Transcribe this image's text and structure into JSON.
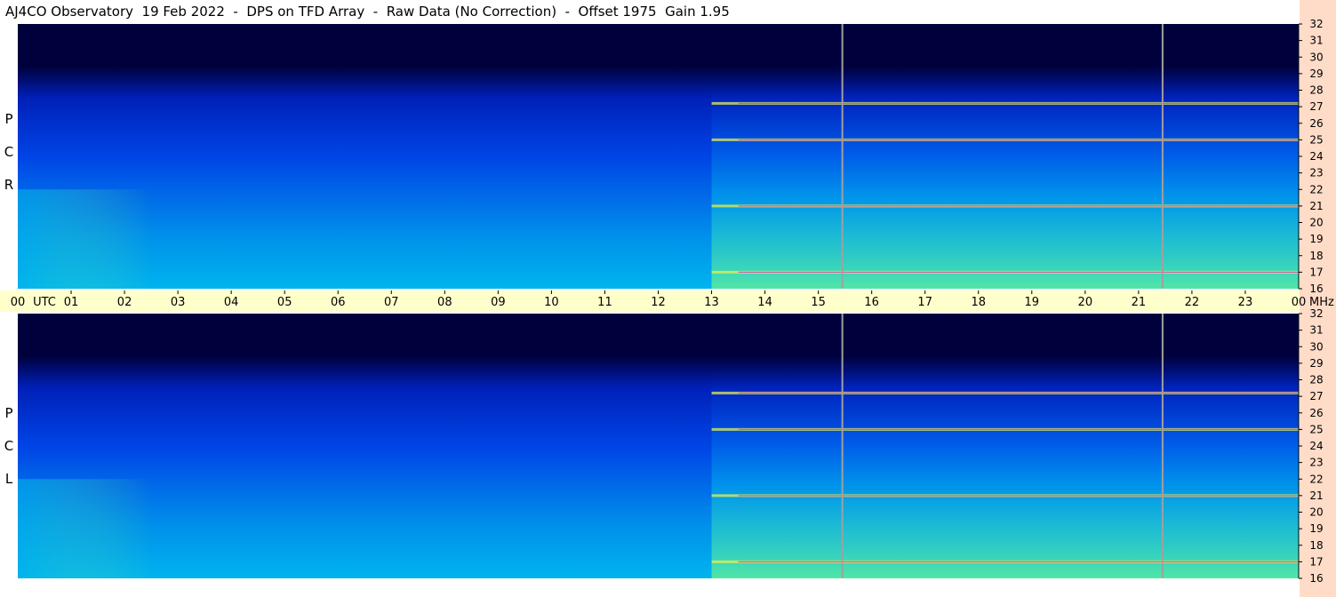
{
  "title": "AJ4CO Observatory  19 Feb 2022  -  DPS on TFD Array  -  Raw Data (No Correction)  -  Offset 1975  Gain 1.95",
  "colors": {
    "background": "#ffffff",
    "utc_band": "#ffffcc",
    "side_band": "#ffdcc8",
    "spectro_dark": "#00003c",
    "spectro_blue": "#0044e6",
    "spectro_cyan": "#00b4ee",
    "spectro_green": "#5fee9a",
    "spectro_yellow": "#e6f050",
    "spectro_magenta": "#d03cbe",
    "marker_line": "#a0a0a0"
  },
  "chart_data": {
    "type": "heatmap",
    "title": "AJ4CO Observatory  19 Feb 2022  -  DPS on TFD Array  -  Raw Data (No Correction)  -  Offset 1975  Gain 1.95",
    "x_axis": {
      "start_label": "00",
      "unit_label": "UTC",
      "tick_labels": [
        "01",
        "02",
        "03",
        "04",
        "05",
        "06",
        "07",
        "08",
        "09",
        "10",
        "11",
        "12",
        "13",
        "14",
        "15",
        "16",
        "17",
        "18",
        "19",
        "20",
        "21",
        "22",
        "23"
      ],
      "end_label": "00",
      "end_unit_label": "MHz",
      "range_hours": [
        0,
        24
      ]
    },
    "y_axis": {
      "unit": "MHz",
      "range": [
        16,
        32
      ],
      "tick_labels": [
        "32",
        "31",
        "30",
        "29",
        "28",
        "27",
        "26",
        "25",
        "24",
        "23",
        "22",
        "21",
        "20",
        "19",
        "18",
        "17",
        "16"
      ]
    },
    "panels": [
      {
        "letters": [
          "R",
          "C",
          "P"
        ]
      },
      {
        "letters": [
          "L",
          "C",
          "P"
        ]
      }
    ],
    "marker_lines_utc": [
      15.45,
      21.45
    ],
    "strong_emission_bands_mhz": [
      27.2,
      25,
      21,
      17
    ]
  }
}
